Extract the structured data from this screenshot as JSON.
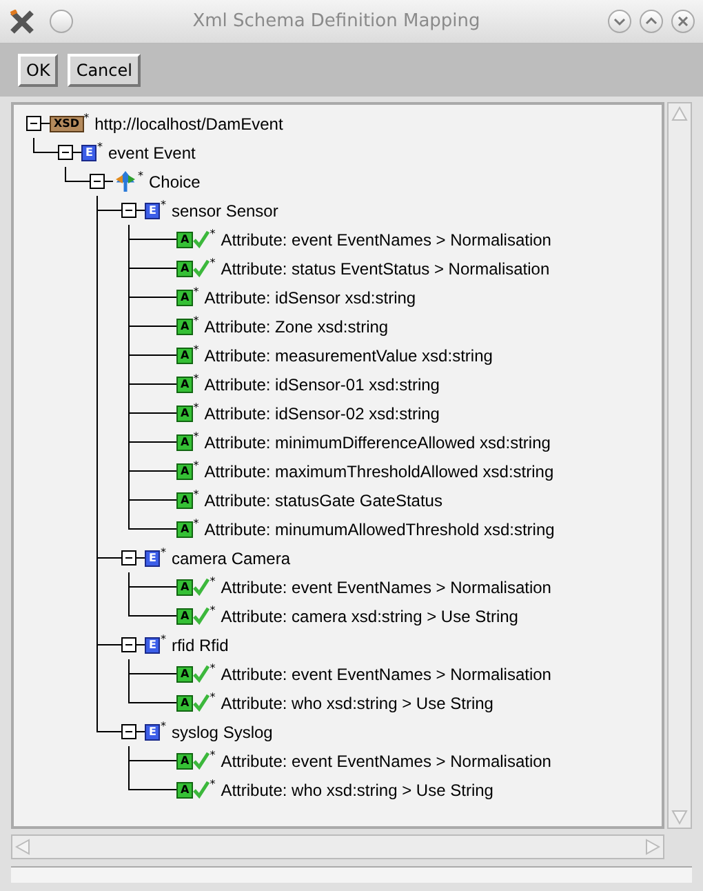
{
  "window": {
    "title": "Xml Schema Definition Mapping"
  },
  "buttons": [
    {
      "label": "OK"
    },
    {
      "label": "Cancel"
    }
  ],
  "tree": [
    {
      "kind": "schema",
      "badge": "XSD",
      "flag": "*",
      "label": "http://localhost/DamEvent",
      "expanded": true,
      "children": [
        {
          "kind": "element",
          "badge": "E",
          "flag": "*",
          "label": "event Event",
          "expanded": true,
          "children": [
            {
              "kind": "choice",
              "flag": "*",
              "label": "Choice",
              "expanded": true,
              "children": [
                {
                  "kind": "element",
                  "badge": "E",
                  "flag": "*",
                  "label": "sensor Sensor",
                  "expanded": true,
                  "children": [
                    {
                      "kind": "attribute",
                      "badge": "A",
                      "flag": "*",
                      "label": "Attribute: event EventNames > Normalisation",
                      "mapped": true
                    },
                    {
                      "kind": "attribute",
                      "badge": "A",
                      "flag": "*",
                      "label": "Attribute: status EventStatus > Normalisation",
                      "mapped": true
                    },
                    {
                      "kind": "attribute",
                      "badge": "A",
                      "flag": "*",
                      "label": "Attribute: idSensor xsd:string",
                      "mapped": false
                    },
                    {
                      "kind": "attribute",
                      "badge": "A",
                      "flag": "*",
                      "label": "Attribute: Zone xsd:string",
                      "mapped": false
                    },
                    {
                      "kind": "attribute",
                      "badge": "A",
                      "flag": "*",
                      "label": "Attribute: measurementValue xsd:string",
                      "mapped": false
                    },
                    {
                      "kind": "attribute",
                      "badge": "A",
                      "flag": "*",
                      "label": "Attribute: idSensor-01 xsd:string",
                      "mapped": false
                    },
                    {
                      "kind": "attribute",
                      "badge": "A",
                      "flag": "*",
                      "label": "Attribute: idSensor-02 xsd:string",
                      "mapped": false
                    },
                    {
                      "kind": "attribute",
                      "badge": "A",
                      "flag": "*",
                      "label": "Attribute: minimumDifferenceAllowed xsd:string",
                      "mapped": false
                    },
                    {
                      "kind": "attribute",
                      "badge": "A",
                      "flag": "*",
                      "label": "Attribute: maximumThresholdAllowed xsd:string",
                      "mapped": false
                    },
                    {
                      "kind": "attribute",
                      "badge": "A",
                      "flag": "*",
                      "label": "Attribute: statusGate GateStatus",
                      "mapped": false
                    },
                    {
                      "kind": "attribute",
                      "badge": "A",
                      "flag": "*",
                      "label": "Attribute: minumumAllowedThreshold xsd:string",
                      "mapped": false
                    }
                  ]
                },
                {
                  "kind": "element",
                  "badge": "E",
                  "flag": "*",
                  "label": "camera Camera",
                  "expanded": true,
                  "children": [
                    {
                      "kind": "attribute",
                      "badge": "A",
                      "flag": "*",
                      "label": "Attribute: event EventNames > Normalisation",
                      "mapped": true
                    },
                    {
                      "kind": "attribute",
                      "badge": "A",
                      "flag": "*",
                      "label": "Attribute: camera xsd:string > Use String",
                      "mapped": true
                    }
                  ]
                },
                {
                  "kind": "element",
                  "badge": "E",
                  "flag": "*",
                  "label": "rfid Rfid",
                  "expanded": true,
                  "children": [
                    {
                      "kind": "attribute",
                      "badge": "A",
                      "flag": "*",
                      "label": "Attribute: event EventNames > Normalisation",
                      "mapped": true
                    },
                    {
                      "kind": "attribute",
                      "badge": "A",
                      "flag": "*",
                      "label": "Attribute: who xsd:string > Use String",
                      "mapped": true
                    }
                  ]
                },
                {
                  "kind": "element",
                  "badge": "E",
                  "flag": "*",
                  "label": "syslog Syslog",
                  "expanded": true,
                  "children": [
                    {
                      "kind": "attribute",
                      "badge": "A",
                      "flag": "*",
                      "label": "Attribute: event EventNames > Normalisation",
                      "mapped": true
                    },
                    {
                      "kind": "attribute",
                      "badge": "A",
                      "flag": "*",
                      "label": "Attribute: who xsd:string > Use String",
                      "mapped": true
                    }
                  ]
                }
              ]
            }
          ]
        }
      ]
    }
  ]
}
